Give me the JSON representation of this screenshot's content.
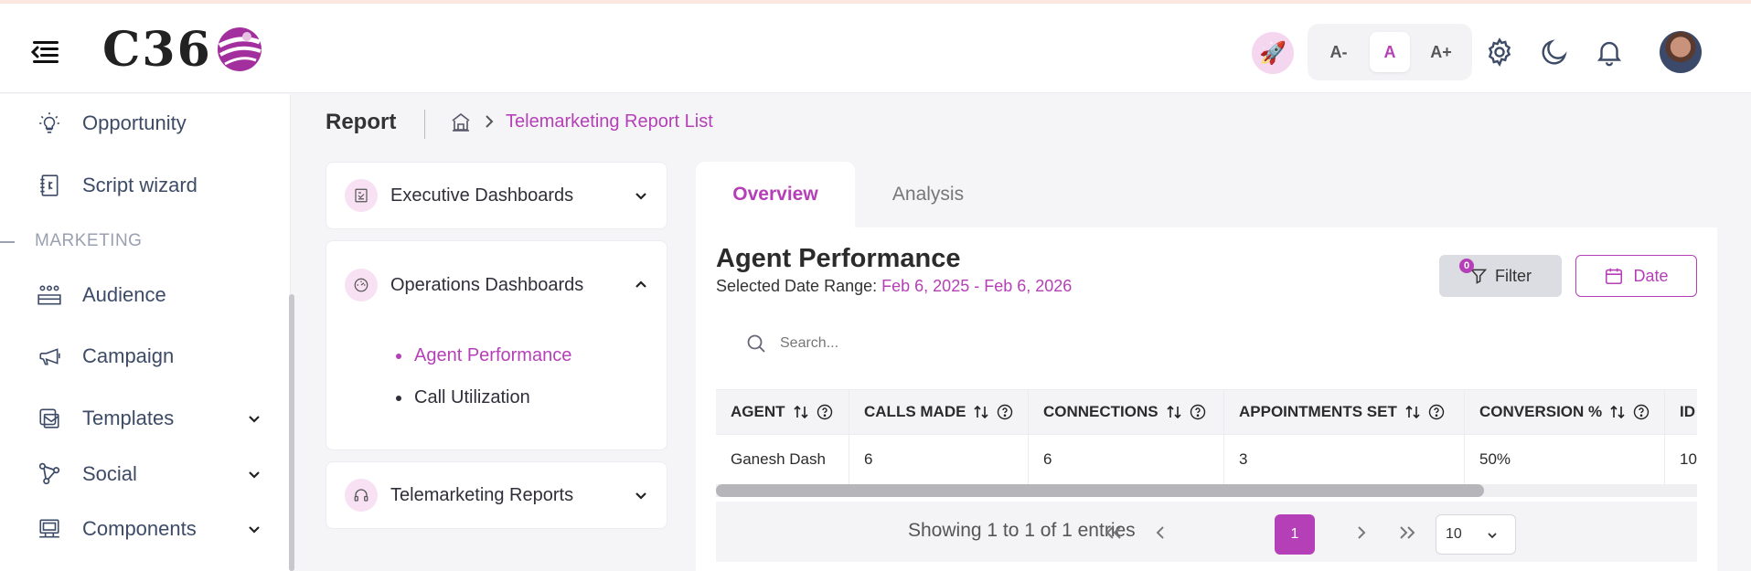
{
  "header": {
    "logo_text": "C36",
    "font_size_buttons": [
      "A-",
      "A",
      "A+"
    ],
    "icons": [
      "menu-toggle-icon",
      "rocket-icon",
      "gear-icon",
      "moon-icon",
      "bell-icon"
    ]
  },
  "sidebar": {
    "section_label": "MARKETING",
    "items": [
      {
        "label": "Opportunity",
        "icon": "lightbulb-icon"
      },
      {
        "label": "Script wizard",
        "icon": "script-icon"
      },
      {
        "label": "Audience",
        "icon": "audience-icon"
      },
      {
        "label": "Campaign",
        "icon": "megaphone-icon"
      },
      {
        "label": "Templates",
        "icon": "templates-icon"
      },
      {
        "label": "Social",
        "icon": "social-icon"
      },
      {
        "label": "Components",
        "icon": "components-icon"
      }
    ]
  },
  "breadcrumb": {
    "page_title": "Report",
    "current": "Telemarketing Report List"
  },
  "dashboards": {
    "executive": "Executive Dashboards",
    "operations": "Operations Dashboards",
    "operations_items": [
      "Agent Performance",
      "Call Utilization"
    ],
    "telemarketing": "Telemarketing Reports"
  },
  "tabs": {
    "overview": "Overview",
    "analysis": "Analysis"
  },
  "report": {
    "title": "Agent Performance",
    "date_range_label": "Selected Date Range:",
    "date_range_value": "Feb 6, 2025 - Feb 6, 2026",
    "filter_label": "Filter",
    "filter_count": "0",
    "date_label": "Date",
    "search_placeholder": "Search..."
  },
  "table": {
    "columns": [
      "AGENT",
      "CALLS MADE",
      "CONNECTIONS",
      "APPOINTMENTS SET",
      "CONVERSION %",
      "ID"
    ],
    "rows": [
      [
        "Ganesh Dash",
        "6",
        "6",
        "3",
        "50%",
        "10"
      ]
    ],
    "horizontal_scroll_position": 0.0
  },
  "pagination": {
    "showing": "Showing 1 to 1 of 1 entries",
    "current_page": "1",
    "page_size": "10"
  },
  "colors": {
    "accent": "#b53fb7",
    "text": "#2f2f3a",
    "background": "#f5f5f8"
  }
}
